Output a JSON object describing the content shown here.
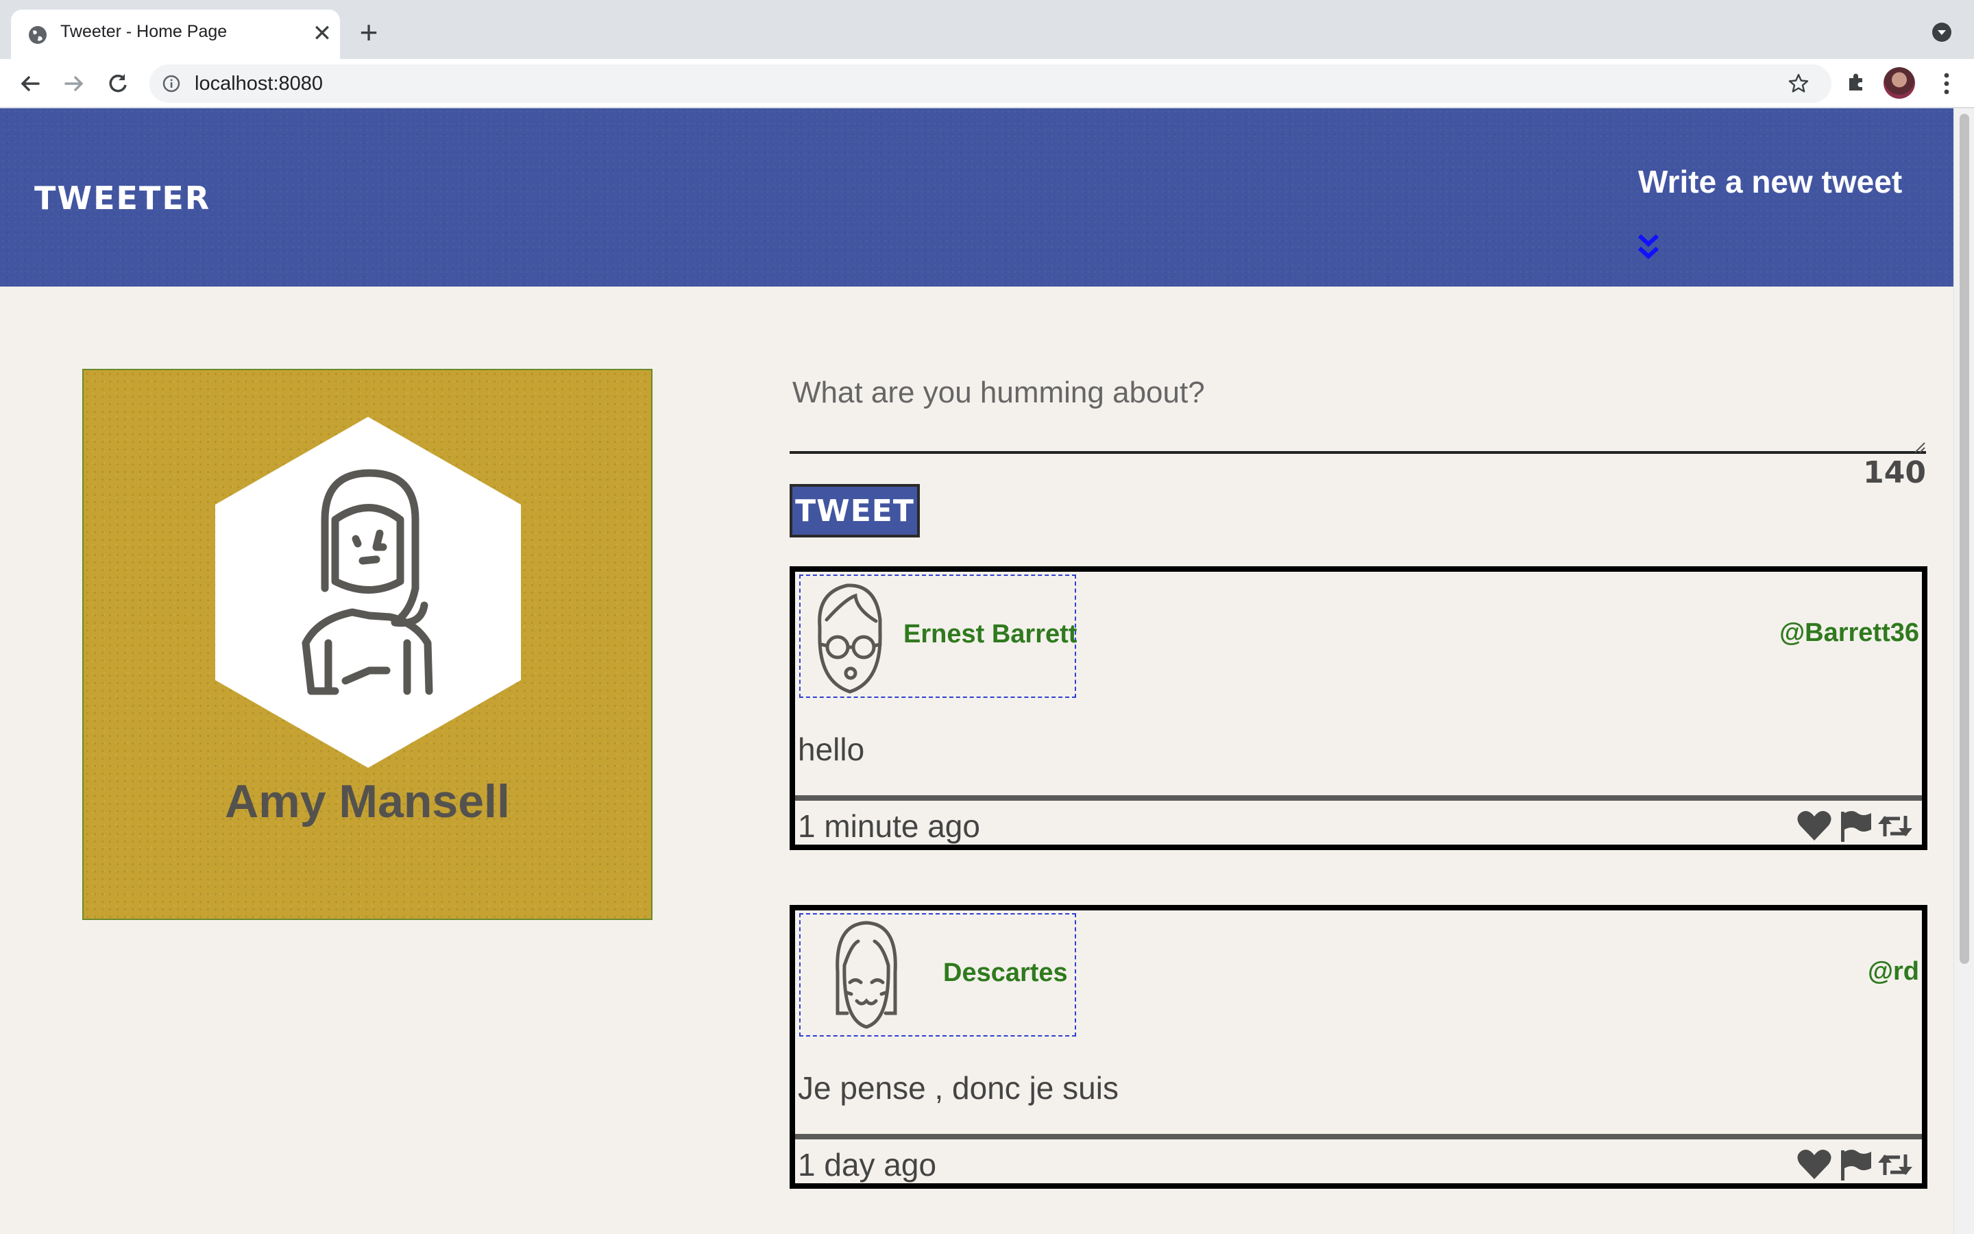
{
  "browser": {
    "tab_title": "Tweeter - Home Page",
    "tab_close": "✕",
    "new_tab": "+",
    "url": "localhost:8080"
  },
  "header": {
    "logo": "TWEETER",
    "write_new": "Write a new tweet",
    "background_color": "#4255a0"
  },
  "profile": {
    "name": "Amy Mansell",
    "avatar_icon": "female-avatar-icon",
    "card_color": "#c5a232"
  },
  "compose": {
    "placeholder": "What are you humming about?",
    "counter": "140",
    "submit_label": "TWEET"
  },
  "tweets": [
    {
      "name": "Ernest Barrett",
      "handle": "@Barrett36",
      "avatar_icon": "male-glasses-avatar-icon",
      "text": "hello",
      "time": "1 minute ago"
    },
    {
      "name": "Descartes",
      "handle": "@rd",
      "avatar_icon": "smiling-avatar-icon",
      "text": "Je pense , donc je suis",
      "time": "1 day ago"
    }
  ],
  "colors": {
    "accent_green": "#2f7a1e",
    "tweet_border": "#000000"
  }
}
